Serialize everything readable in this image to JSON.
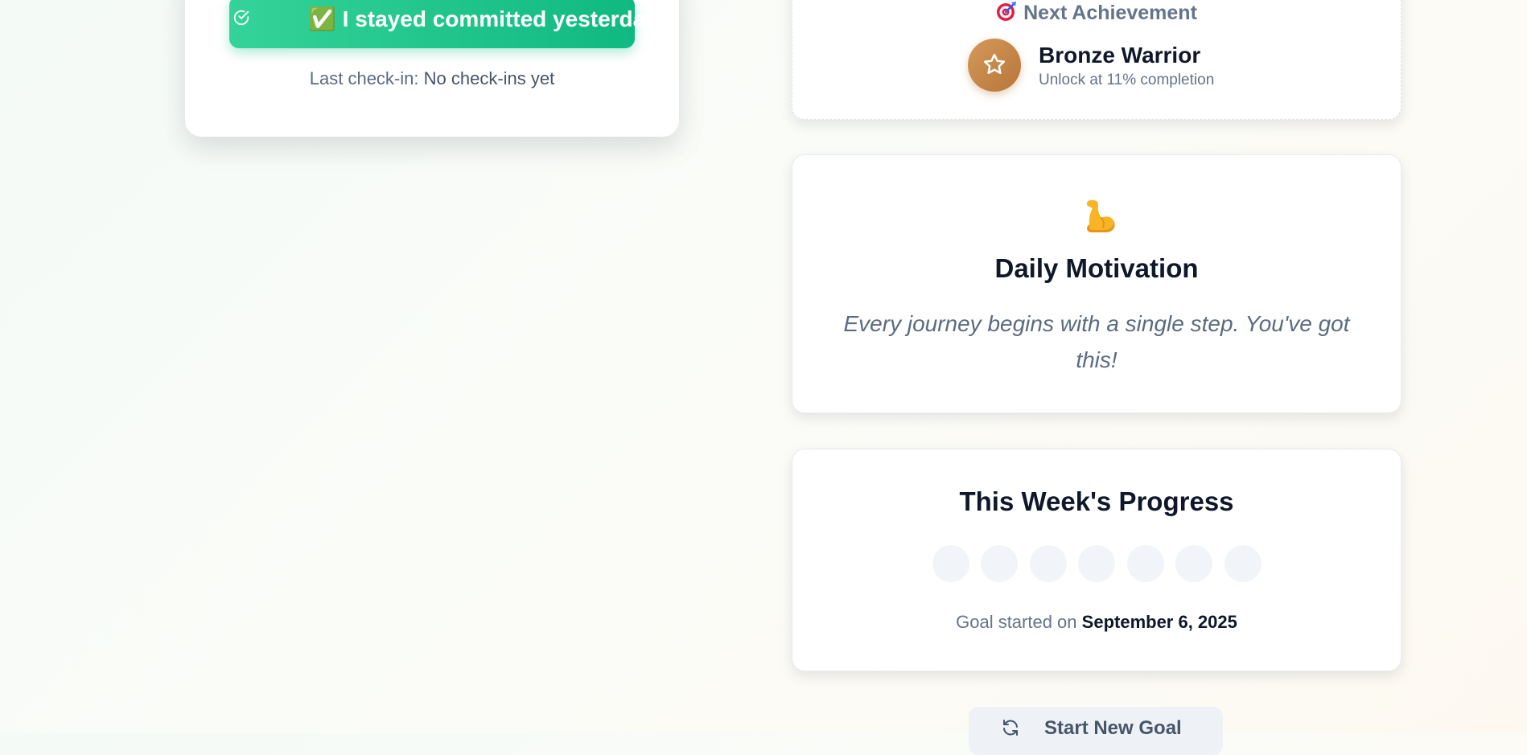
{
  "checkin": {
    "button_label": "✅ I stayed committed yesterday!",
    "last_checkin_label": "Last check-in: ",
    "last_checkin_value": "No check-ins yet"
  },
  "achievement": {
    "header": "Next Achievement",
    "header_icon": "target-icon",
    "badge_icon": "star-icon",
    "title": "Bronze Warrior",
    "subtitle": "Unlock at 11% completion"
  },
  "motivation": {
    "icon": "flexed-biceps-icon",
    "title": "Daily Motivation",
    "quote": "Every journey begins with a single step. You've got this!"
  },
  "week": {
    "title": "This Week's Progress",
    "days_completed": 0,
    "days_total": 7,
    "goal_started_label": "Goal started on ",
    "goal_started_date": "September 6, 2025"
  },
  "actions": {
    "new_goal_label": "Start New Goal",
    "new_goal_icon": "refresh-icon"
  },
  "colors": {
    "primary_green": "#10b981",
    "bronze": "#c4874a",
    "muted_text": "#64748b"
  }
}
